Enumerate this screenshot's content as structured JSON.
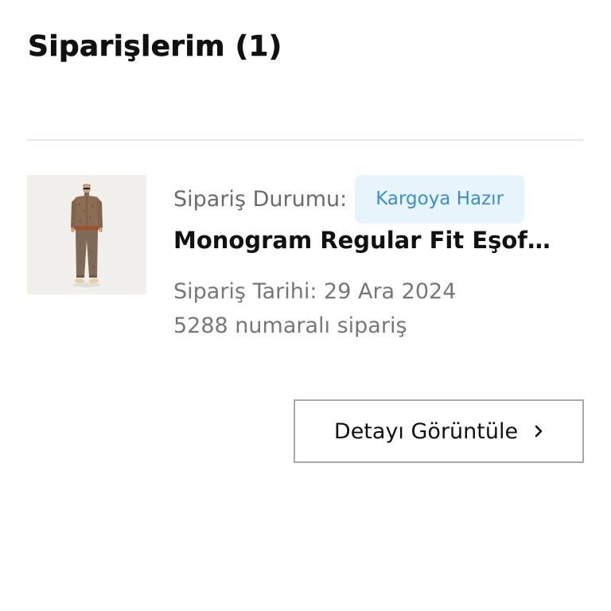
{
  "header": {
    "title": "Siparişlerim (1)"
  },
  "order": {
    "status_label": "Sipariş Durumu:",
    "status_value": "Kargoya Hazır",
    "product_name": "Monogram Regular Fit Eşof…",
    "date_text": "Sipariş Tarihi: 29 Ara 2024",
    "number_text": "5288 numaralı sipariş",
    "product_image_icon": "product-image",
    "status_colors": {
      "badge_background": "#e8f4fb",
      "badge_text": "#3a8fd0"
    }
  },
  "actions": {
    "detail_label": "Detayı Görüntüle",
    "detail_icon": "chevron-right-icon"
  }
}
